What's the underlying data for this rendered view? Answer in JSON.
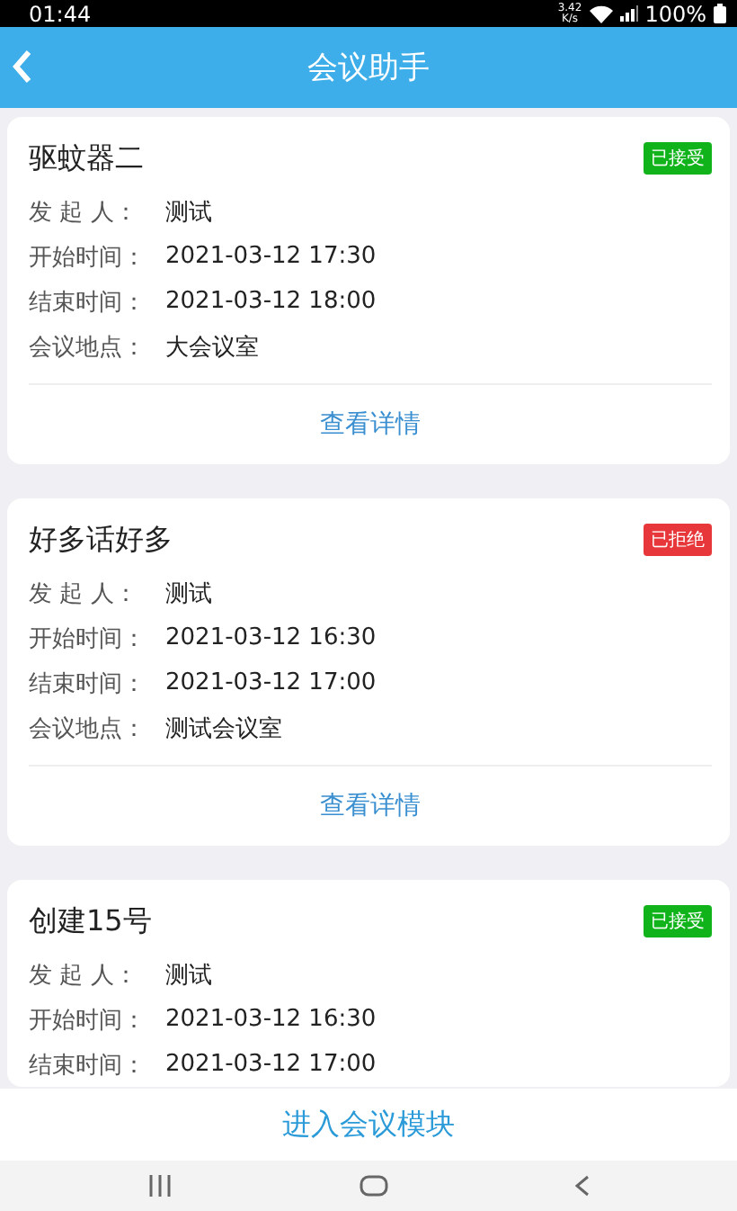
{
  "status_bar": {
    "time": "01:44",
    "speed_value": "3.42",
    "speed_unit": "K/s",
    "battery": "100%"
  },
  "header": {
    "title": "会议助手"
  },
  "meetings": [
    {
      "title": "驱蚊器二",
      "status": {
        "kind": "accepted",
        "label": "已接受"
      },
      "fields": [
        {
          "label": "发 起 人：",
          "value": "测试"
        },
        {
          "label": "开始时间：",
          "value": "2021-03-12 17:30"
        },
        {
          "label": "结束时间：",
          "value": "2021-03-12 18:00"
        },
        {
          "label": "会议地点：",
          "value": "大会议室"
        }
      ],
      "link": "查看详情"
    },
    {
      "title": "好多话好多",
      "status": {
        "kind": "rejected",
        "label": "已拒绝"
      },
      "fields": [
        {
          "label": "发 起 人：",
          "value": "测试"
        },
        {
          "label": "开始时间：",
          "value": "2021-03-12 16:30"
        },
        {
          "label": "结束时间：",
          "value": "2021-03-12 17:00"
        },
        {
          "label": "会议地点：",
          "value": "测试会议室"
        }
      ],
      "link": "查看详情"
    },
    {
      "title": "创建15号",
      "status": {
        "kind": "accepted",
        "label": "已接受"
      },
      "fields": [
        {
          "label": "发 起 人：",
          "value": "测试"
        },
        {
          "label": "开始时间：",
          "value": "2021-03-12 16:30"
        },
        {
          "label": "结束时间：",
          "value": "2021-03-12 17:00"
        }
      ]
    }
  ],
  "footer_button": "进入会议模块"
}
